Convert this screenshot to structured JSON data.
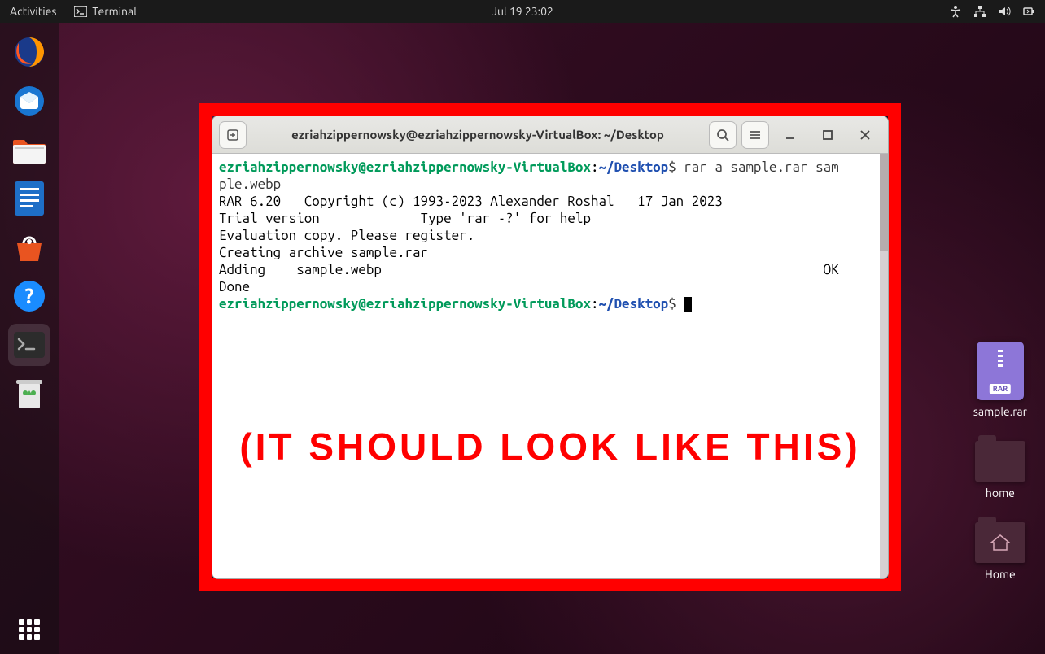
{
  "topbar": {
    "activities": "Activities",
    "app_name": "Terminal",
    "datetime": "Jul 19  23:02"
  },
  "dock": {
    "items": [
      "firefox",
      "thunderbird",
      "files",
      "writer",
      "software",
      "help",
      "terminal",
      "trash"
    ]
  },
  "desktop_icons": {
    "rar_label": "sample.rar",
    "rar_badge": "RAR",
    "home_label": "home",
    "home_folder_label": "Home"
  },
  "terminal": {
    "title": "ezriahzippernowsky@ezriahzippernowsky-VirtualBox: ~/Desktop",
    "prompt": {
      "user_host": "ezriahzippernowsky@ezriahzippernowsky-VirtualBox",
      "colon": ":",
      "path": "~/Desktop",
      "dollar": "$"
    },
    "command_wrapped_a": " rar a sample.rar sam",
    "command_wrapped_b": "ple.webp",
    "lines": [
      "",
      "RAR 6.20   Copyright (c) 1993-2023 Alexander Roshal   17 Jan 2023",
      "Trial version             Type 'rar -?' for help",
      "",
      "Evaluation copy. Please register.",
      "",
      "Creating archive sample.rar",
      "",
      "Adding    sample.webp                                                         OK ",
      "Done"
    ]
  },
  "overlay": "(IT SHOULD LOOK LIKE THIS)"
}
